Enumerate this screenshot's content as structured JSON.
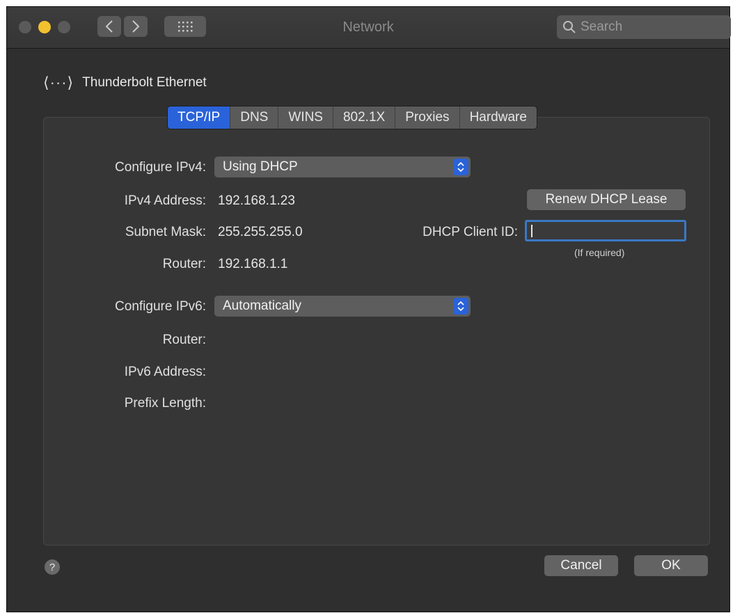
{
  "window": {
    "title": "Network"
  },
  "search": {
    "placeholder": "Search"
  },
  "header": {
    "interface_name": "Thunderbolt Ethernet",
    "icon": "network-interface-icon"
  },
  "tabs": [
    {
      "label": "TCP/IP",
      "active": true
    },
    {
      "label": "DNS"
    },
    {
      "label": "WINS"
    },
    {
      "label": "802.1X"
    },
    {
      "label": "Proxies"
    },
    {
      "label": "Hardware"
    }
  ],
  "ipv4": {
    "configure_label": "Configure IPv4:",
    "configure_value": "Using DHCP",
    "address_label": "IPv4 Address:",
    "address_value": "192.168.1.23",
    "subnet_label": "Subnet Mask:",
    "subnet_value": "255.255.255.0",
    "router_label": "Router:",
    "router_value": "192.168.1.1",
    "renew_button": "Renew DHCP Lease",
    "client_id_label": "DHCP Client ID:",
    "client_id_value": "",
    "client_id_hint": "(If required)"
  },
  "ipv6": {
    "configure_label": "Configure IPv6:",
    "configure_value": "Automatically",
    "router_label": "Router:",
    "address_label": "IPv6 Address:",
    "prefix_label": "Prefix Length:"
  },
  "footer": {
    "help": "?",
    "cancel": "Cancel",
    "ok": "OK"
  },
  "colors": {
    "accent": "#2a63d9",
    "focus_ring": "#3a78c4",
    "window_bg": "#2f2f2f",
    "yellow_light": "#f2c12e"
  }
}
